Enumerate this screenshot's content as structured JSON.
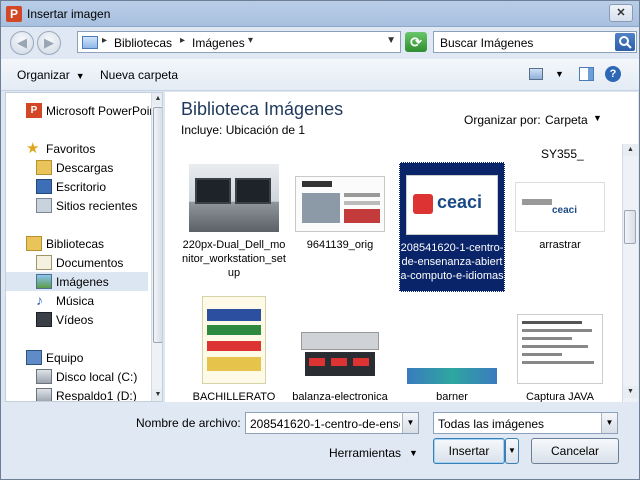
{
  "window": {
    "title": "Insertar imagen",
    "app_icon_letter": "P",
    "close_glyph": "✕"
  },
  "address": {
    "parts": [
      "Bibliotecas",
      "Imágenes"
    ],
    "search_placeholder": "Buscar Imágenes"
  },
  "toolbar": {
    "organize": "Organizar",
    "new_folder": "Nueva carpeta",
    "help_glyph": "?"
  },
  "nav": {
    "items": [
      {
        "label": "Microsoft PowerPoint",
        "icon": "powerpoint-icon"
      },
      {
        "label": "Favoritos",
        "icon": "star-icon"
      },
      {
        "label": "Descargas",
        "icon": "downloads-folder-icon"
      },
      {
        "label": "Escritorio",
        "icon": "desktop-icon"
      },
      {
        "label": "Sitios recientes",
        "icon": "recent-places-icon"
      },
      {
        "label": "Bibliotecas",
        "icon": "libraries-icon"
      },
      {
        "label": "Documentos",
        "icon": "documents-icon"
      },
      {
        "label": "Imágenes",
        "icon": "pictures-icon",
        "selected": true
      },
      {
        "label": "Música",
        "icon": "music-icon"
      },
      {
        "label": "Vídeos",
        "icon": "videos-icon"
      },
      {
        "label": "Equipo",
        "icon": "computer-icon"
      },
      {
        "label": "Disco local (C:)",
        "icon": "local-disk-icon"
      },
      {
        "label": "Respaldo1 (D:)",
        "icon": "drive-icon"
      }
    ]
  },
  "main": {
    "title": "Biblioteca Imágenes",
    "includes": "Incluye:  Ubicación de 1",
    "arrange_label": "Organizar por:",
    "arrange_value": "Carpeta",
    "top_label": "SY355_",
    "items": [
      {
        "caption": "220px-Dual_Dell_monitor_workstation_setup"
      },
      {
        "caption": "9641139_orig"
      },
      {
        "caption": "208541620-1-centro-de-ensenanza-abierta-computo-e-idiomas",
        "selected": true
      },
      {
        "caption": "arrastrar"
      },
      {
        "caption": "BACHILLERATO"
      },
      {
        "caption": "balanza-electronica"
      },
      {
        "caption": "barner"
      },
      {
        "caption": "Captura JAVA"
      }
    ]
  },
  "bottom": {
    "filename_label": "Nombre de archivo:",
    "filename_value": "208541620-1-centro-de-ense",
    "type_value": "Todas las imágenes",
    "tools": "Herramientas",
    "insert": "Insertar",
    "cancel": "Cancelar"
  }
}
